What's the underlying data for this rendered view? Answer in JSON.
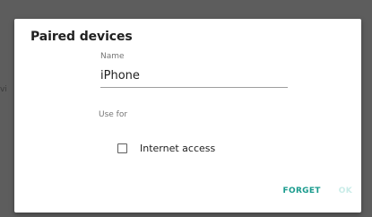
{
  "backdrop": {
    "partial_text": "vi"
  },
  "dialog": {
    "title": "Paired devices",
    "name_field": {
      "label": "Name",
      "value": "iPhone"
    },
    "use_for": {
      "label": "Use for",
      "options": [
        {
          "label": "Internet access",
          "checked": false
        }
      ]
    },
    "actions": {
      "forget_label": "FORGET",
      "ok_label": "OK"
    }
  },
  "colors": {
    "accent": "#199b8d",
    "accent_disabled": "#c9ece8",
    "scrim": "#5d5d5d",
    "dialog_bg": "#ffffff"
  }
}
